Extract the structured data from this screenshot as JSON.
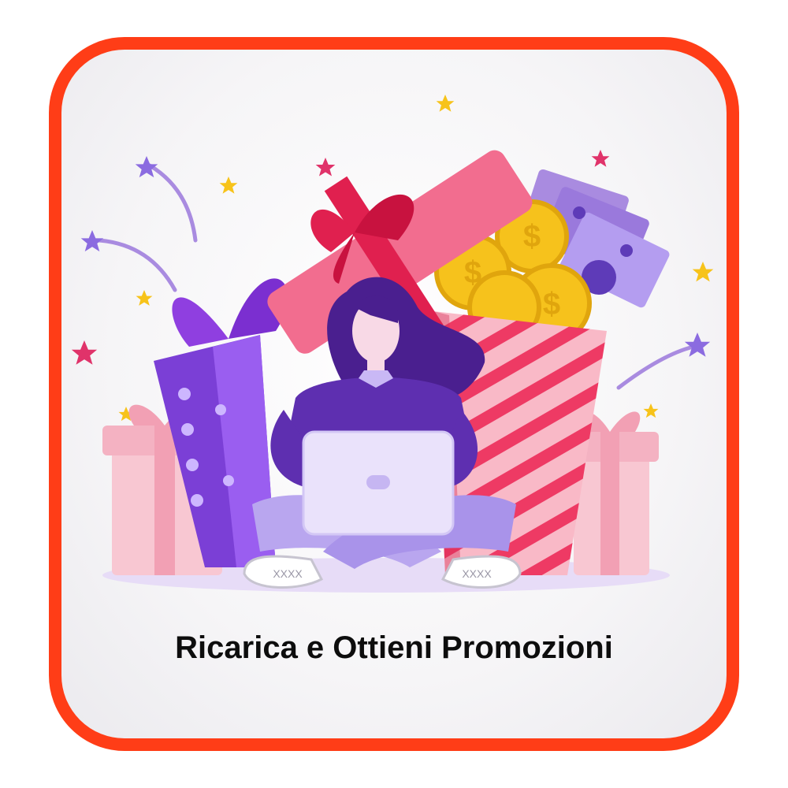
{
  "card": {
    "caption": "Ricarica e Ottieni Promozioni",
    "border_color": "#ff3d17"
  },
  "illustration": {
    "subject": "woman-with-laptop-among-gifts",
    "icons": [
      "star-icon",
      "gift-icon",
      "coin-icon",
      "banknote-icon",
      "laptop-icon"
    ],
    "coin_symbol": "$",
    "shoe_text": "XXXX",
    "colors": {
      "purple": "#7b3fd6",
      "pink": "#f26d8f",
      "red": "#e0204f",
      "gold": "#f6c21c",
      "lavender": "#b9a6ef",
      "light_pink": "#f8c7d2"
    }
  }
}
